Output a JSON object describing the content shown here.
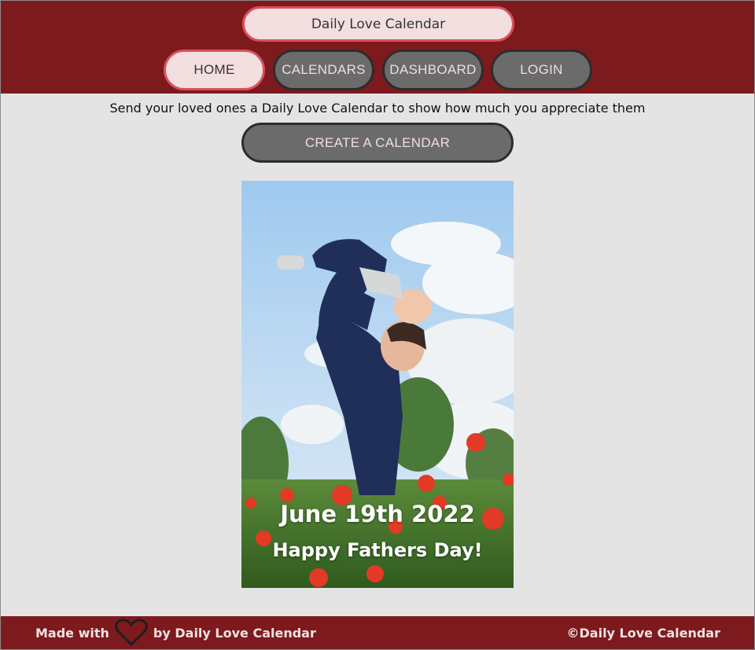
{
  "brand": {
    "title": "Daily Love Calendar"
  },
  "nav": {
    "items": [
      {
        "label": "HOME",
        "active": true
      },
      {
        "label": "CALENDARS",
        "active": false
      },
      {
        "label": "DASHBOARD",
        "active": false
      },
      {
        "label": "LOGIN",
        "active": false
      }
    ]
  },
  "main": {
    "tagline": "Send your loved ones a Daily Love Calendar to show how much you appreciate them",
    "cta_label": "CREATE A CALENDAR",
    "hero": {
      "date": "June 19th 2022",
      "message": "Happy Fathers Day!"
    }
  },
  "footer": {
    "made_with": "Made with",
    "made_by": "by Daily Love Calendar",
    "copyright": "©Daily Love Calendar",
    "heart_icon": "heart-outline-icon"
  },
  "colors": {
    "header_bg": "#7d1a1d",
    "page_bg": "#e4e4e4",
    "active_pill": "#f3dfe0",
    "active_border": "#d9525a",
    "idle_pill": "#6b6b6b"
  }
}
